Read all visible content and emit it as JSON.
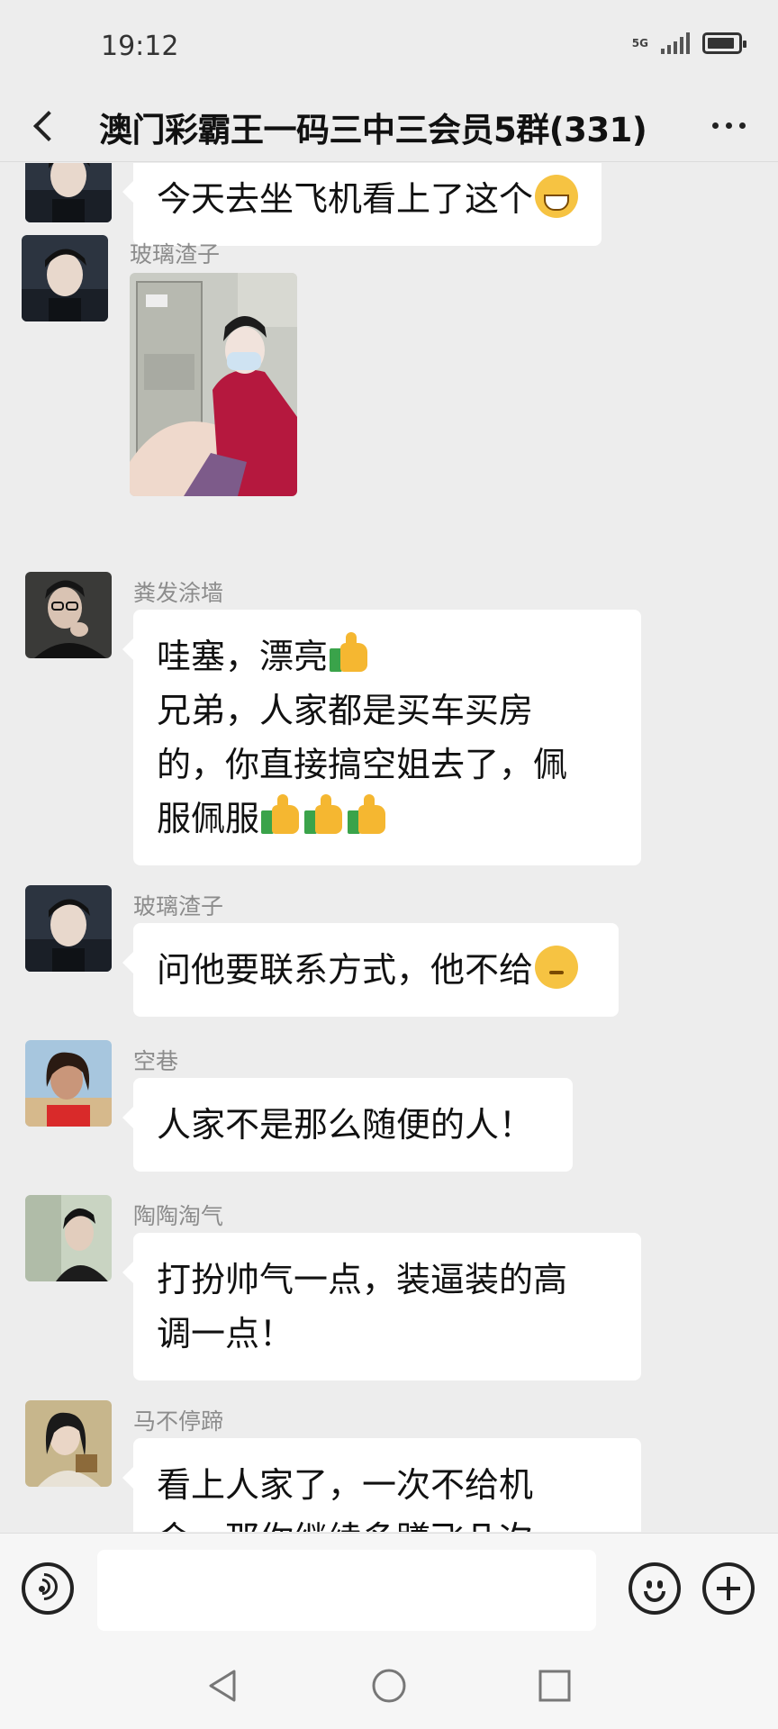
{
  "status_bar": {
    "time": "19:12",
    "network": "5G",
    "battery_level": 0.9
  },
  "header": {
    "title": "澳门彩霸王一码三中三会员5群(331)",
    "back_icon": "chevron-left-icon",
    "more_icon": "more-horizontal-icon"
  },
  "messages": [
    {
      "sender": "",
      "lines": [
        "今天去坐飞机看上了这个"
      ],
      "emoji": "grin"
    },
    {
      "sender": "玻璃渣子",
      "type": "image"
    },
    {
      "sender": "粪发涂墙",
      "lines": [
        "哇塞，漂亮",
        "兄弟，人家都是买车买房",
        "的，你直接搞空姐去了，佩",
        "服佩服"
      ]
    },
    {
      "sender": "玻璃渣子",
      "lines": [
        "问他要联系方式，他不给"
      ],
      "emoji": "thinking"
    },
    {
      "sender": "空巷",
      "lines": [
        "人家不是那么随便的人！"
      ]
    },
    {
      "sender": "陶陶淘气",
      "lines": [
        "打扮帅气一点，装逼装的高",
        "调一点！"
      ]
    },
    {
      "sender": "马不停蹄",
      "lines": [
        "看上人家了，一次不给机",
        "会，那你继续多蹲飞几次"
      ]
    }
  ],
  "input_bar": {
    "placeholder": "",
    "voice_icon": "voice-icon",
    "emoji_icon": "emoji-icon",
    "plus_icon": "plus-icon"
  },
  "nav_bar": {
    "back_icon": "nav-back-icon",
    "home_icon": "nav-home-icon",
    "recent_icon": "nav-recent-icon"
  },
  "colors": {
    "background": "#ededed",
    "bubble": "#ffffff",
    "sender_name": "#8c8c8c"
  }
}
